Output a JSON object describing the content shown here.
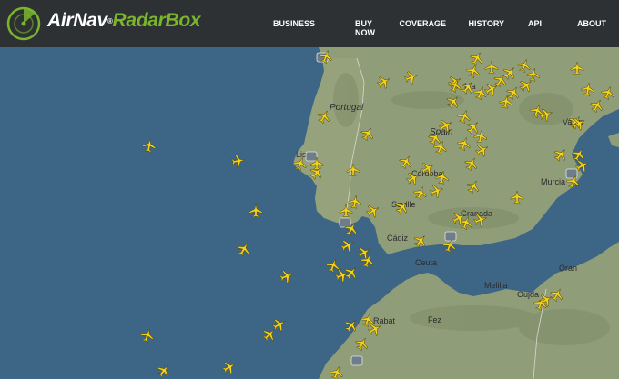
{
  "header": {
    "brand_part1": "AirNav",
    "brand_reg": "®",
    "brand_part2": "RadarBox",
    "nav": [
      "BUSINESS",
      "BUY NOW",
      "COVERAGE",
      "HISTORY",
      "API",
      "ABOUT"
    ]
  },
  "map": {
    "labels": {
      "portugal": "Portugal",
      "spain": "Spain",
      "madrid": "Ma",
      "lisbon": "Lis",
      "cordoba": "Córdoba",
      "seville": "Seville",
      "granada": "Granada",
      "murcia": "Murcia",
      "valencia": "Valen",
      "cadiz": "Cádiz",
      "ceuta": "Ceuta",
      "melilla": "Melilla",
      "oran": "Oran",
      "oujda": "Oujda",
      "fez": "Fez",
      "rabat": "Rabat"
    },
    "colors": {
      "ocean": "#3d6585",
      "land": "#8c9b77",
      "plane": "#f2d21b"
    }
  }
}
